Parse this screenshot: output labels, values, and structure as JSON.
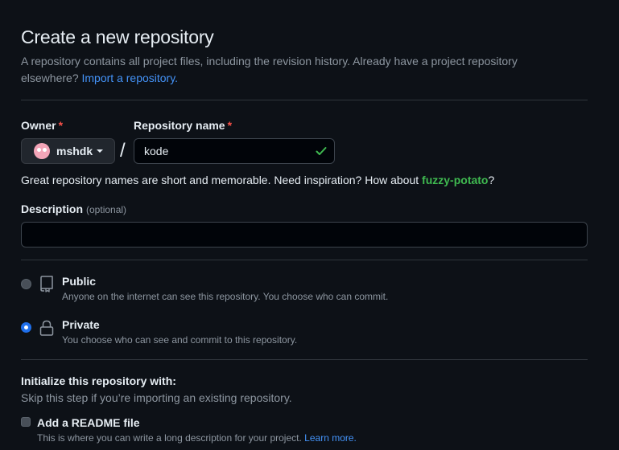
{
  "header": {
    "title": "Create a new repository",
    "subtitle": "A repository contains all project files, including the revision history. Already have a project repository elsewhere?",
    "import_link": "Import a repository."
  },
  "owner": {
    "label": "Owner",
    "required_mark": "*",
    "value": "mshdk"
  },
  "separator": "/",
  "repo_name": {
    "label": "Repository name",
    "required_mark": "*",
    "value": "kode"
  },
  "hint": {
    "text": "Great repository names are short and memorable. Need inspiration? How about",
    "suggestion": "fuzzy-potato",
    "suffix": "?"
  },
  "description": {
    "label": "Description",
    "optional": "(optional)",
    "value": ""
  },
  "visibility": {
    "public": {
      "title": "Public",
      "desc": "Anyone on the internet can see this repository. You choose who can commit."
    },
    "private": {
      "title": "Private",
      "desc": "You choose who can see and commit to this repository."
    }
  },
  "init": {
    "title": "Initialize this repository with:",
    "subtitle": "Skip this step if you’re importing an existing repository.",
    "readme_label": "Add a README file",
    "readme_desc": "This is where you can write a long description for your project.",
    "learn_more": "Learn more."
  },
  "colors": {
    "background": "#0d1117",
    "link": "#4493f8",
    "success": "#3fb950",
    "required": "#f85149",
    "radio_selected": "#1f6feb"
  },
  "icons": {
    "valid": "check-icon",
    "public": "repo-icon",
    "private": "lock-icon"
  }
}
